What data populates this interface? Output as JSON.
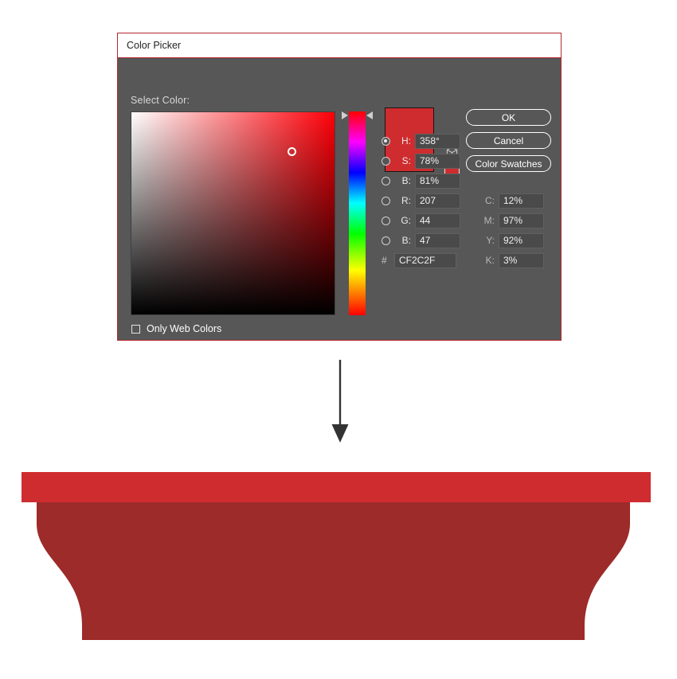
{
  "dialog": {
    "title": "Color Picker",
    "select_color_label": "Select Color:",
    "buttons": {
      "ok": "OK",
      "cancel": "Cancel",
      "color_swatches": "Color Swatches"
    },
    "only_web_colors_label": "Only Web Colors",
    "hash_label": "#",
    "icons": {
      "cube": "cube-icon"
    },
    "fields": {
      "hsb": [
        {
          "label": "H:",
          "value": "358°",
          "selected": true
        },
        {
          "label": "S:",
          "value": "78%",
          "selected": false
        },
        {
          "label": "B:",
          "value": "81%",
          "selected": false
        }
      ],
      "rgb": [
        {
          "label": "R:",
          "value": "207",
          "selected": false
        },
        {
          "label": "G:",
          "value": "44",
          "selected": false
        },
        {
          "label": "B:",
          "value": "47",
          "selected": false
        }
      ],
      "cmyk": [
        {
          "label": "C:",
          "value": "12%"
        },
        {
          "label": "M:",
          "value": "97%"
        },
        {
          "label": "Y:",
          "value": "92%"
        },
        {
          "label": "K:",
          "value": "3%"
        }
      ],
      "hex": {
        "label": "#",
        "value": "CF2C2F"
      }
    }
  },
  "colors": {
    "selected_hex": "#CF2C2F",
    "dialog_background": "#575757",
    "dialog_border": "#B3272D",
    "titlebar_background": "#FFFFFF",
    "art_top_bar": "#CF2C2F",
    "art_body": "#9C2B2A",
    "arrow": "#333333"
  },
  "artwork": {
    "name": "red-pedestal-shape",
    "description": "Red pedestal / table base illustration filled with the picked color"
  }
}
